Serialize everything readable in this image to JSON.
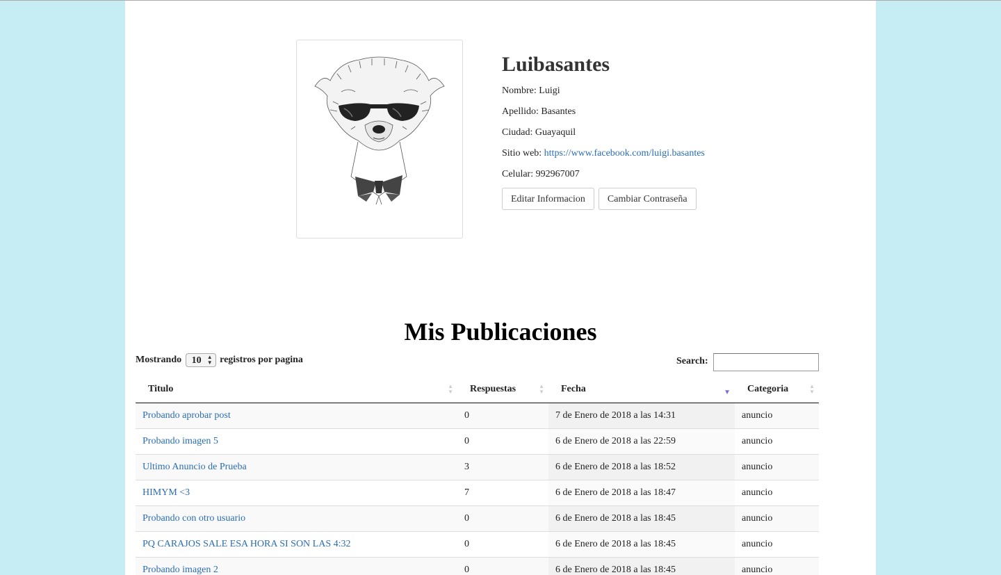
{
  "profile": {
    "username": "Luibasantes",
    "nombre_label": "Nombre:",
    "nombre": "Luigi",
    "apellido_label": "Apellido:",
    "apellido": "Basantes",
    "ciudad_label": "Ciudad:",
    "ciudad": "Guayaquil",
    "sitio_label": "Sitio web:",
    "sitio": "https://www.facebook.com/luigi.basantes",
    "celular_label": "Celular:",
    "celular": "992967007",
    "edit_button": "Editar Informacion",
    "password_button": "Cambiar Contraseña"
  },
  "publications": {
    "title": "Mis Publicaciones",
    "length_prefix": "Mostrando",
    "length_value": "10",
    "length_suffix": "registros por pagina",
    "search_label": "Search:",
    "columns": [
      "Titulo",
      "Respuestas",
      "Fecha",
      "Categoria"
    ],
    "rows": [
      {
        "titulo": "Probando aprobar post",
        "respuestas": "0",
        "fecha": "7 de Enero de 2018 a las 14:31",
        "categoria": "anuncio"
      },
      {
        "titulo": "Probando imagen 5",
        "respuestas": "0",
        "fecha": "6 de Enero de 2018 a las 22:59",
        "categoria": "anuncio"
      },
      {
        "titulo": "Ultimo Anuncio de Prueba",
        "respuestas": "3",
        "fecha": "6 de Enero de 2018 a las 18:52",
        "categoria": "anuncio"
      },
      {
        "titulo": "HIMYM <3",
        "respuestas": "7",
        "fecha": "6 de Enero de 2018 a las 18:47",
        "categoria": "anuncio"
      },
      {
        "titulo": "Probando con otro usuario",
        "respuestas": "0",
        "fecha": "6 de Enero de 2018 a las 18:45",
        "categoria": "anuncio"
      },
      {
        "titulo": "PQ CARAJOS SALE ESA HORA SI SON LAS 4:32",
        "respuestas": "0",
        "fecha": "6 de Enero de 2018 a las 18:45",
        "categoria": "anuncio"
      },
      {
        "titulo": "Probando imagen 2",
        "respuestas": "0",
        "fecha": "6 de Enero de 2018 a las 18:45",
        "categoria": "anuncio"
      }
    ]
  },
  "colors": {
    "background": "#c6edf4",
    "link": "#2a6db5",
    "sort_active": "#7b6fd6"
  }
}
